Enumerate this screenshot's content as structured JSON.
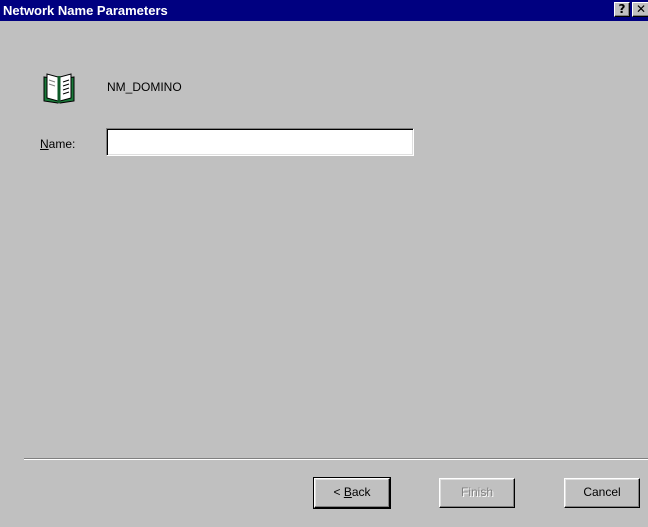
{
  "window": {
    "title": "Network Name Parameters",
    "help_label": "?",
    "close_label": "✕"
  },
  "resource": {
    "name": "NM_DOMINO",
    "icon": "open-book-icon"
  },
  "form": {
    "name_label_mnemonic": "N",
    "name_label_rest": "ame:",
    "name_value": ""
  },
  "buttons": {
    "back_prefix": "< ",
    "back_mnemonic": "B",
    "back_rest": "ack",
    "finish_label": "Finish",
    "cancel_label": "Cancel",
    "finish_enabled": false
  },
  "colors": {
    "titlebar": "#000080",
    "dialog_face": "#c0c0c0",
    "icon_green": "#1a7a3a"
  }
}
